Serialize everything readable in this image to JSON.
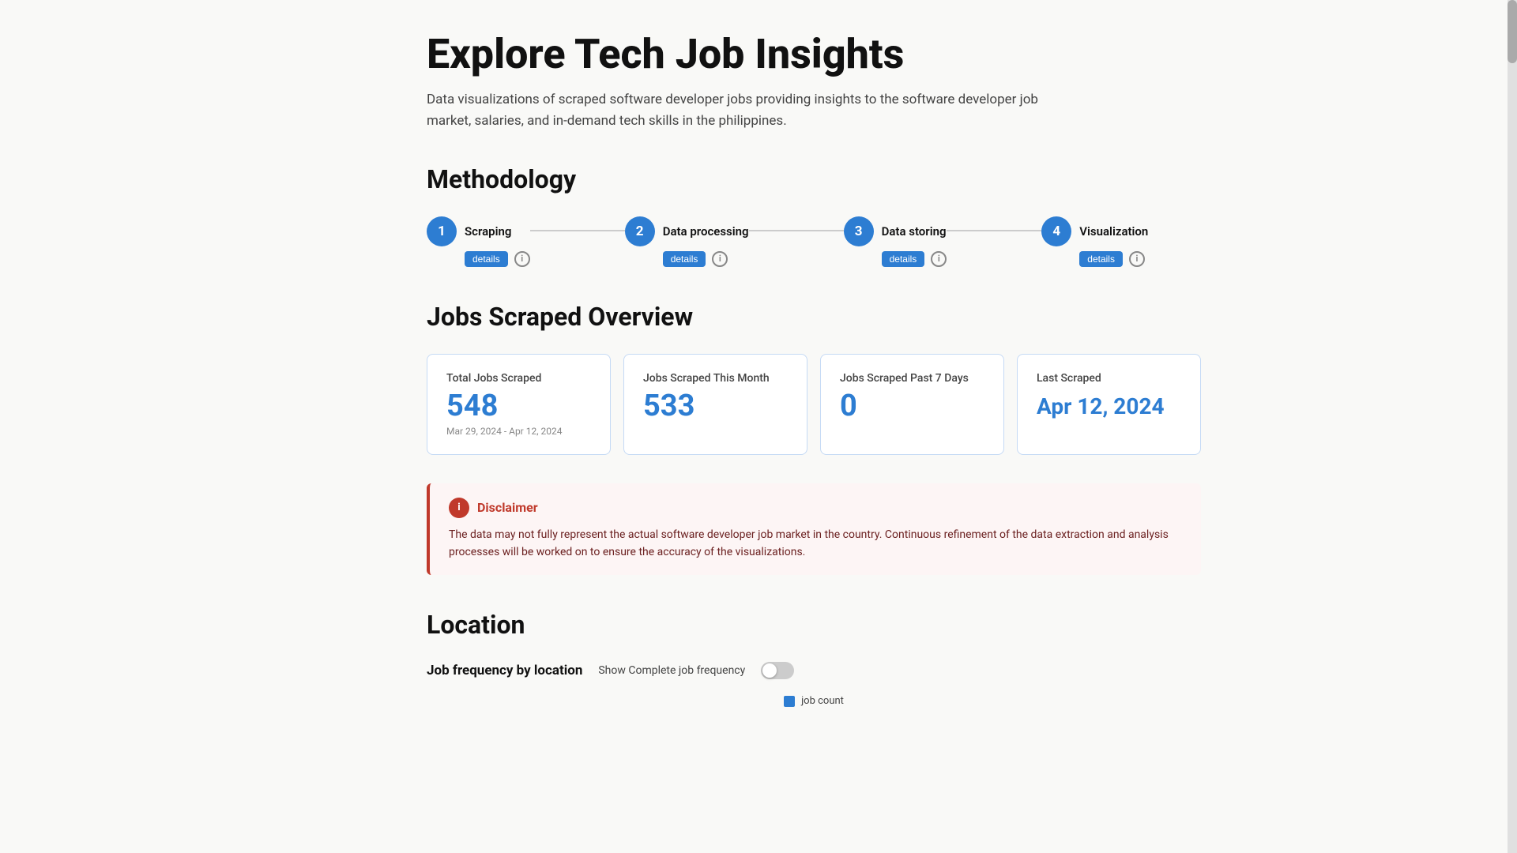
{
  "page": {
    "title": "Explore Tech Job Insights",
    "subtitle": "Data visualizations of scraped software developer jobs providing insights to the software developer job market, salaries, and in-demand tech skills in the philippines."
  },
  "methodology": {
    "section_title": "Methodology",
    "steps": [
      {
        "number": "1",
        "name": "Scraping",
        "details_label": "details",
        "info": "i"
      },
      {
        "number": "2",
        "name": "Data processing",
        "details_label": "details",
        "info": "i"
      },
      {
        "number": "3",
        "name": "Data storing",
        "details_label": "details",
        "info": "i"
      },
      {
        "number": "4",
        "name": "Visualization",
        "details_label": "details",
        "info": "i"
      }
    ]
  },
  "overview": {
    "section_title": "Jobs Scraped Overview",
    "cards": [
      {
        "label": "Total Jobs Scraped",
        "value": "548",
        "sub": "Mar 29, 2024 - Apr 12, 2024"
      },
      {
        "label": "Jobs Scraped This Month",
        "value": "533",
        "sub": ""
      },
      {
        "label": "Jobs Scraped Past 7 Days",
        "value": "0",
        "sub": ""
      },
      {
        "label": "Last Scraped",
        "value": "Apr 12, 2024",
        "sub": ""
      }
    ]
  },
  "disclaimer": {
    "icon": "i",
    "title": "Disclaimer",
    "text": "The data may not fully represent the actual software developer job market in the country. Continuous refinement of the data extraction and analysis processes will be worked on to ensure the accuracy of the visualizations."
  },
  "location": {
    "section_title": "Location",
    "frequency_label": "Job frequency by location",
    "toggle_label": "Show Complete job frequency",
    "legend_label": "job count"
  },
  "colors": {
    "accent": "#2d7dd2",
    "disclaimer_red": "#c0392b",
    "disclaimer_bg": "#fdf5f5"
  }
}
